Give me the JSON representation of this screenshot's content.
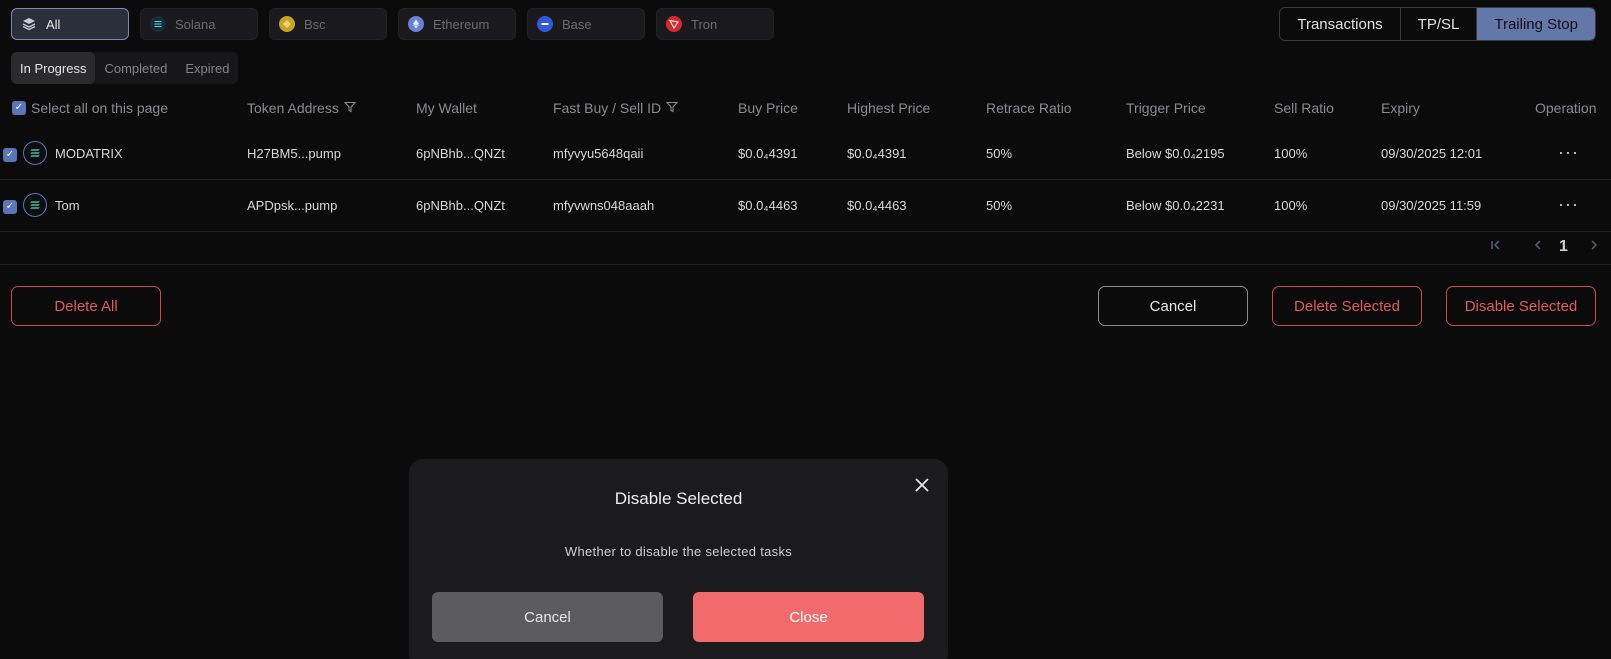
{
  "chains": [
    {
      "label": "All",
      "icon": "layers-icon",
      "color": "#9aa3b8"
    },
    {
      "label": "Solana",
      "icon": "solana-icon",
      "color": "#1b2a3a"
    },
    {
      "label": "Bsc",
      "icon": "bsc-icon",
      "color": "#c9a227"
    },
    {
      "label": "Ethereum",
      "icon": "ethereum-icon",
      "color": "#6c7fd8"
    },
    {
      "label": "Base",
      "icon": "base-icon",
      "color": "#2f5bd8"
    },
    {
      "label": "Tron",
      "icon": "tron-icon",
      "color": "#d8282e"
    }
  ],
  "mode_tabs": [
    "Transactions",
    "TP/SL",
    "Trailing Stop"
  ],
  "status_tabs": [
    "In Progress",
    "Completed",
    "Expired"
  ],
  "columns": {
    "select_all": "Select all on this page",
    "token_address": "Token Address",
    "my_wallet": "My Wallet",
    "fast_id": "Fast Buy / Sell ID",
    "buy_price": "Buy Price",
    "highest_price": "Highest Price",
    "retrace_ratio": "Retrace Ratio",
    "trigger_price": "Trigger Price",
    "sell_ratio": "Sell Ratio",
    "expiry": "Expiry",
    "operation": "Operation"
  },
  "rows": [
    {
      "name": "MODATRIX",
      "token": "H27BM5...pump",
      "wallet": "6pNBhb...QNZt",
      "fast_id": "mfyvyu5648qaii",
      "buy": "$0.0₄4391",
      "highest": "$0.0₄4391",
      "retrace": "50%",
      "trigger": "Below $0.0₄2195",
      "sell": "100%",
      "expiry": "09/30/2025 12:01"
    },
    {
      "name": "Tom",
      "token": "APDpsk...pump",
      "wallet": "6pNBhb...QNZt",
      "fast_id": "mfyvwns048aaah",
      "buy": "$0.0₄4463",
      "highest": "$0.0₄4463",
      "retrace": "50%",
      "trigger": "Below $0.0₄2231",
      "sell": "100%",
      "expiry": "09/30/2025 11:59"
    }
  ],
  "pager": {
    "page": "1"
  },
  "actions": {
    "delete_all": "Delete All",
    "cancel": "Cancel",
    "delete_selected": "Delete Selected",
    "disable_selected": "Disable Selected"
  },
  "modal": {
    "title": "Disable Selected",
    "message": "Whether to disable the selected tasks",
    "cancel": "Cancel",
    "close": "Close"
  }
}
